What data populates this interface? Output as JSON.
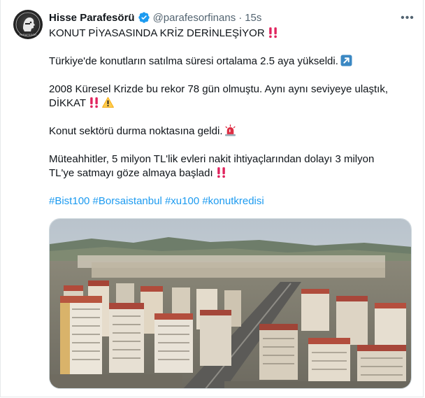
{
  "tweet": {
    "author_name": "Hisse Parafesörü",
    "handle": "@parafesorfinans",
    "separator": "·",
    "time": "15s",
    "avatar_text": "PARAFESÖR",
    "more_label": "•••",
    "lines": {
      "title": "KONUT PİYASASINDA KRİZ DERİNLEŞİYOR",
      "p1": "Türkiye'de konutların satılma süresi ortalama 2.5 aya yükseldi.",
      "p2a": "2008 Küresel Krizde bu rekor 78 gün olmuştu. Aynı aynı seviyeye ulaştık,",
      "p2b": "DİKKAT",
      "p3": "Konut sektörü durma noktasına geldi.",
      "p4a": "Müteahhitler, 5 milyon TL'lik evleri nakit ihtiyaçlarından dolayı 3 milyon",
      "p4b": "TL'ye satmayı göze almaya başladı"
    },
    "hashtags": [
      "#Bist100",
      "#Borsaistanbul",
      "#xu100",
      "#konutkredisi"
    ],
    "emojis": [
      "double-exclamation",
      "up-right-arrow",
      "double-exclamation",
      "warning",
      "police-light",
      "double-exclamation"
    ],
    "colors": {
      "link": "#1d9bf0",
      "verified": "#1d9bf0",
      "secondary_text": "#536471",
      "emoji_red": "#e0245e"
    }
  }
}
